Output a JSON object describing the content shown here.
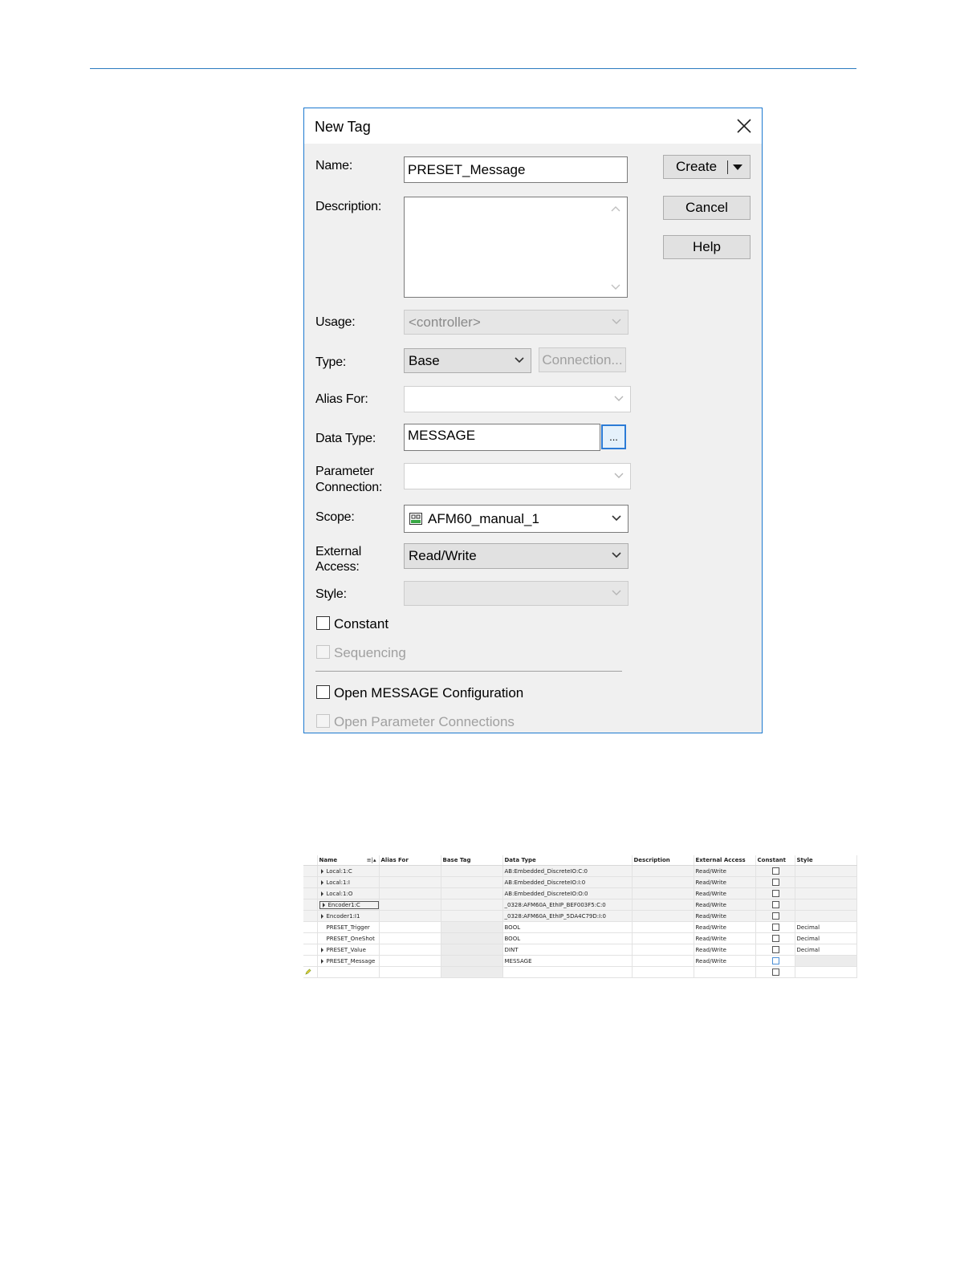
{
  "dialog": {
    "title": "New Tag",
    "labels": {
      "name": "Name:",
      "description": "Description:",
      "usage": "Usage:",
      "type": "Type:",
      "alias_for": "Alias For:",
      "data_type": "Data Type:",
      "parameter_connection_1": "Parameter",
      "parameter_connection_2": "Connection:",
      "scope": "Scope:",
      "external_access_1": "External",
      "external_access_2": "Access:",
      "style": "Style:"
    },
    "values": {
      "name": "PRESET_Message",
      "description": "",
      "usage": "<controller>",
      "type": "Base",
      "alias_for": "",
      "data_type": "MESSAGE",
      "parameter_connection": "",
      "scope": "AFM60_manual_1",
      "external_access": "Read/Write",
      "style": ""
    },
    "buttons": {
      "create": "Create",
      "cancel": "Cancel",
      "help": "Help",
      "connection": "Connection...",
      "browse": "..."
    },
    "checkboxes": {
      "constant": "Constant",
      "sequencing": "Sequencing",
      "open_message_configuration": "Open MESSAGE Configuration",
      "open_parameter_connections": "Open Parameter Connections"
    }
  },
  "grid": {
    "columns": [
      "Name",
      "Alias For",
      "Base Tag",
      "Data Type",
      "Description",
      "External Access",
      "Constant",
      "Style"
    ],
    "rows": [
      {
        "name": "Local:1:C",
        "data_type": "AB:Embedded_DiscreteIO:C:0",
        "access": "Read/Write",
        "style": ""
      },
      {
        "name": "Local:1:I",
        "data_type": "AB:Embedded_DiscreteIO:I:0",
        "access": "Read/Write",
        "style": ""
      },
      {
        "name": "Local:1:O",
        "data_type": "AB:Embedded_DiscreteIO:O:0",
        "access": "Read/Write",
        "style": ""
      },
      {
        "name": "Encoder1:C",
        "data_type": "_0328:AFM60A_EthIP_BEF003F5:C:0",
        "access": "Read/Write",
        "style": ""
      },
      {
        "name": "Encoder1:I1",
        "data_type": "_0328:AFM60A_EthIP_5DA4C79D:I:0",
        "access": "Read/Write",
        "style": ""
      },
      {
        "name": "PRESET_Trigger",
        "data_type": "BOOL",
        "access": "Read/Write",
        "style": "Decimal"
      },
      {
        "name": "PRESET_OneShot",
        "data_type": "BOOL",
        "access": "Read/Write",
        "style": "Decimal"
      },
      {
        "name": "PRESET_Value",
        "data_type": "DINT",
        "access": "Read/Write",
        "style": "Decimal"
      },
      {
        "name": "PRESET_Message",
        "data_type": "MESSAGE",
        "access": "Read/Write",
        "style": ""
      }
    ]
  }
}
